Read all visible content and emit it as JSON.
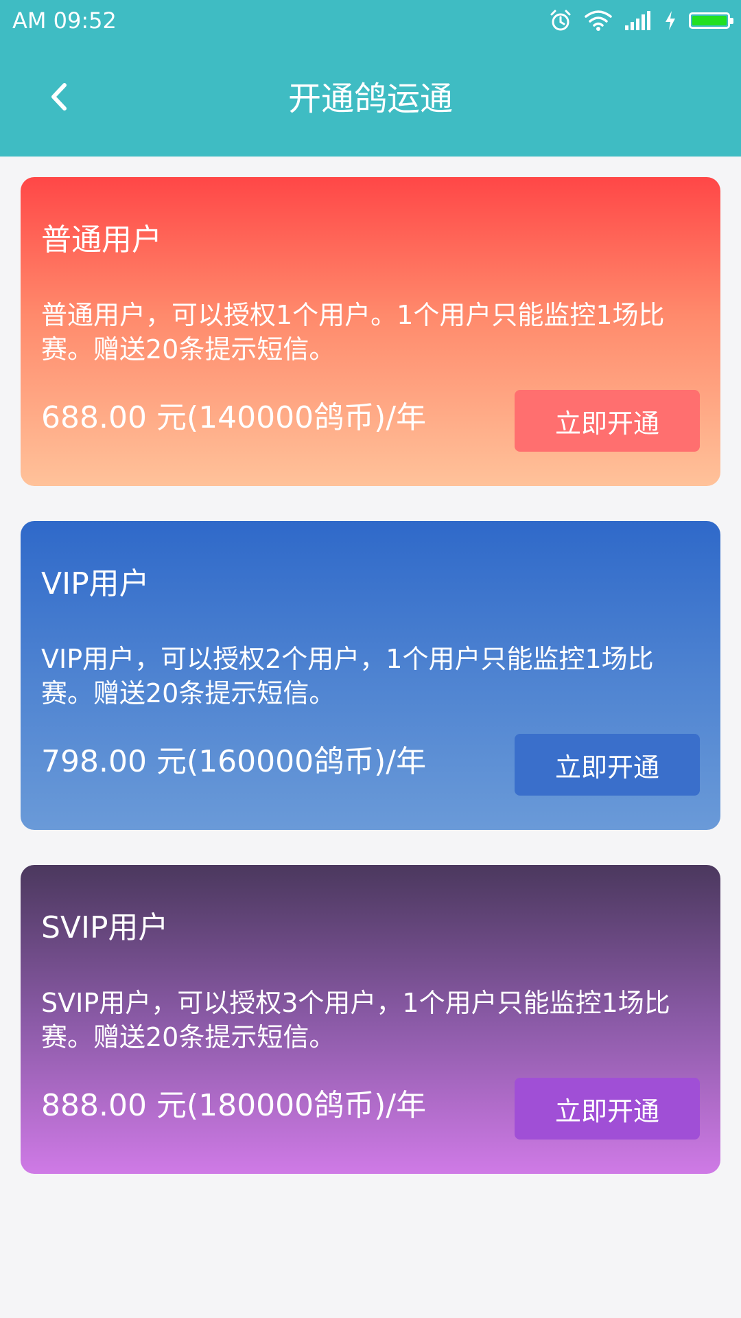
{
  "status_bar": {
    "time": "AM  09:52",
    "icons": [
      "alarm-icon",
      "wifi-icon",
      "signal-icon",
      "charging-icon",
      "battery-icon"
    ],
    "battery_level": 1.0,
    "battery_color": "#22e022"
  },
  "header": {
    "title": "开通鸽运通",
    "back_icon": "chevron-left-icon",
    "background": "#3fbcc3"
  },
  "plans": [
    {
      "title": "普通用户",
      "description": "普通用户，可以授权1个用户。1个用户只能监控1场比赛。赠送20条提示短信。",
      "price": "688.00 元(140000鸽币)/年",
      "button_label": "立即开通",
      "colors": {
        "top": "#ff4747",
        "bottom": "#ffc29a",
        "button": "#ff6f6f"
      }
    },
    {
      "title": "VIP用户",
      "description": "VIP用户，可以授权2个用户，1个用户只能监控1场比赛。赠送20条提示短信。",
      "price": "798.00 元(160000鸽币)/年",
      "button_label": "立即开通",
      "colors": {
        "top": "#2f69c9",
        "bottom": "#6a9ad8",
        "button": "#3a6fcb"
      }
    },
    {
      "title": "SVIP用户",
      "description": "SVIP用户，可以授权3个用户，1个用户只能监控1场比赛。赠送20条提示短信。",
      "price": "888.00 元(180000鸽币)/年",
      "button_label": "立即开通",
      "colors": {
        "top": "#4b385e",
        "bottom": "#cf7ae6",
        "button": "#a04fd6"
      }
    }
  ]
}
